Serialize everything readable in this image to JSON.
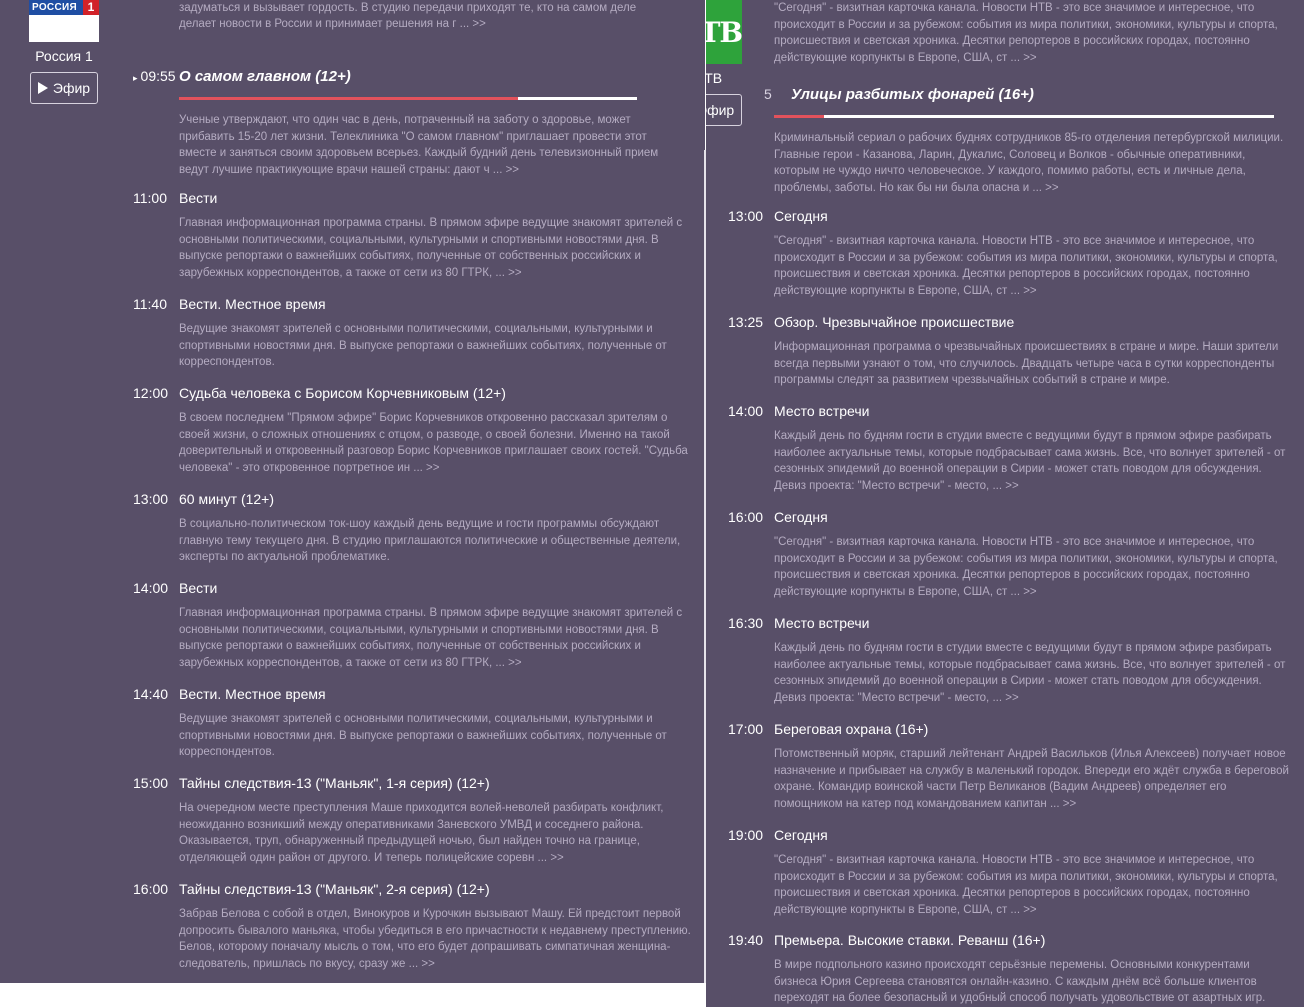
{
  "left": {
    "logo_text": "РОССИЯ",
    "logo_number": "1",
    "channel_name": "Россия 1",
    "live_label": "Эфир",
    "top_fragment": "о том, что интересует каждого жителя большой страны, о том, что тревожит, заставляет задуматься и вызывает гордость. В студию передачи приходят те, кто на самом деле делает новости в России и принимает решения на г ... >>",
    "current": {
      "time": "09:55",
      "title": "О самом главном (12+)",
      "progress": 0.74,
      "desc": "Ученые утверждают, что один час в день, потраченный на заботу о здоровье, может прибавить 15-20 лет жизни. Телеклиника \"О самом главном\" приглашает провести этот вместе и заняться своим здоровьем всерьез. Каждый будний день телевизионный прием ведут лучшие практикующие врачи нашей страны: дают ч ... >>"
    },
    "programs": [
      {
        "time": "11:00",
        "title": "Вести",
        "desc": "Главная информационная программа страны. В прямом эфире ведущие знакомят зрителей с основными политическими, социальными, культурными и спортивными новостями дня. В выпуске репортажи о важнейших событиях, полученные от собственных российских и зарубежных корреспондентов, а также от сети из 80 ГТРК, ... >>"
      },
      {
        "time": "11:40",
        "title": "Вести. Местное время",
        "desc": "Ведущие знакомят зрителей с основными политическими, социальными, культурными и спортивными новостями дня. В выпуске репортажи о важнейших событиях, полученные от корреспондентов."
      },
      {
        "time": "12:00",
        "title": "Судьба человека с Борисом Корчевниковым (12+)",
        "desc": "В своем последнем \"Прямом эфире\" Борис Корчевников откровенно рассказал зрителям о своей жизни, о сложных отношениях с отцом, о разводе, о своей болезни. Именно на такой доверительный и откровенный разговор Борис Корчевников приглашает своих гостей. \"Судьба человека\" - это откровенное портретное ин ... >>"
      },
      {
        "time": "13:00",
        "title": "60 минут (12+)",
        "desc": "В социально-политическом ток-шоу каждый день ведущие и гости программы обсуждают главную тему текущего дня. В студию приглашаются политические и общественные деятели, эксперты по актуальной проблематике."
      },
      {
        "time": "14:00",
        "title": "Вести",
        "desc": "Главная информационная программа страны. В прямом эфире ведущие знакомят зрителей с основными политическими, социальными, культурными и спортивными новостями дня. В выпуске репортажи о важнейших событиях, полученные от собственных российских и зарубежных корреспондентов, а также от сети из 80 ГТРК, ... >>"
      },
      {
        "time": "14:40",
        "title": "Вести. Местное время",
        "desc": "Ведущие знакомят зрителей с основными политическими, социальными, культурными и спортивными новостями дня. В выпуске репортажи о важнейших событиях, полученные от корреспондентов."
      },
      {
        "time": "15:00",
        "title": "Тайны следствия-13 (\"Маньяк\", 1-я серия) (12+)",
        "desc": "На очередном месте преступления Маше приходится волей-неволей разбирать конфликт, неожиданно возникший между оперативниками Заневского УМВД и соседнего района. Оказывается, труп, обнаруженный предыдущей ночью, был найден точно на границе, отделяющей один район от другого. И теперь полицейские соревн ... >>"
      },
      {
        "time": "16:00",
        "title": "Тайны следствия-13 (\"Маньяк\", 2-я серия) (12+)",
        "desc": "Забрав Белова с собой в отдел, Винокуров и Курочкин вызывают Машу. Ей предстоит первой допросить бывалого маньяка, чтобы убедиться в его причастности к недавнему преступлению. Белов, которому поначалу мысль о том, что его будет допрашивать симпатичная женщина-следователь, пришлась по вкусу, сразу же ... >>"
      }
    ]
  },
  "right": {
    "logo_text": "НТВ",
    "channel_name": "НТВ",
    "live_label": "Эфир",
    "top_fragment": "\"Сегодня\" - визитная карточка канала. Новости НТВ - это все значимое и интересное, что происходит в России и за рубежом: события из мира политики, экономики, культуры и спорта, происшествия и светская хроника. Десятки репортеров в российских городах, постоянно действующие корпункты в Европе, США, ст ... >>",
    "current": {
      "time_fragment": "5",
      "title": "Улицы разбитых фонарей (16+)",
      "progress": 0.1,
      "desc": "Криминальный сериал о рабочих буднях сотрудников 85-го отделения петербургской милиции. Главные герои - Казанова, Ларин, Дукалис, Соловец и Волков - обычные оперативники, которым не чуждо ничто человеческое. У каждого, помимо работы, есть и личные дела, проблемы, заботы. Но как бы ни была опасна и ... >>"
    },
    "programs": [
      {
        "time": "13:00",
        "title": "Сегодня",
        "desc": "\"Сегодня\" - визитная карточка канала. Новости НТВ - это все значимое и интересное, что происходит в России и за рубежом: события из мира политики, экономики, культуры и спорта, происшествия и светская хроника. Десятки репортеров в российских городах, постоянно действующие корпункты в Европе, США, ст ... >>"
      },
      {
        "time": "13:25",
        "title": "Обзор. Чрезвычайное происшествие",
        "desc": "Информационная программа о чрезвычайных происшествиях в стране и мире. Наши зрители всегда первыми узнают о том, что случилось. Двадцать четыре часа в сутки корреспонденты программы следят за развитием чрезвычайных событий в стране и мире."
      },
      {
        "time": "14:00",
        "title": "Место встречи",
        "desc": "Каждый день по будням гости в студии вместе с ведущими будут в прямом эфире разбирать наиболее актуальные темы, которые подбрасывает сама жизнь. Все, что волнует зрителей - от сезонных эпидемий до военной операции в Сирии - может стать поводом для обсуждения. Девиз проекта: \"Место встречи\" - место, ... >>"
      },
      {
        "time": "16:00",
        "title": "Сегодня",
        "desc": "\"Сегодня\" - визитная карточка канала. Новости НТВ - это все значимое и интересное, что происходит в России и за рубежом: события из мира политики, экономики, культуры и спорта, происшествия и светская хроника. Десятки репортеров в российских городах, постоянно действующие корпункты в Европе, США, ст ... >>"
      },
      {
        "time": "16:30",
        "title": "Место встречи",
        "desc": "Каждый день по будням гости в студии вместе с ведущими будут в прямом эфире разбирать наиболее актуальные темы, которые подбрасывает сама жизнь. Все, что волнует зрителей - от сезонных эпидемий до военной операции в Сирии - может стать поводом для обсуждения. Девиз проекта: \"Место встречи\" - место, ... >>"
      },
      {
        "time": "17:00",
        "title": "Береговая охрана (16+)",
        "desc": "Потомственный моряк, старший лейтенант Андрей Васильков (Илья Алексеев) получает новое назначение и прибывает на службу в маленький городок. Впереди его ждёт служба в береговой охране. Командир воинской части Петр Великанов (Вадим Андреев) определяет его помощником на катер под командованием капитан ... >>"
      },
      {
        "time": "19:00",
        "title": "Сегодня",
        "desc": "\"Сегодня\" - визитная карточка канала. Новости НТВ - это все значимое и интересное, что происходит в России и за рубежом: события из мира политики, экономики, культуры и спорта, происшествия и светская хроника. Десятки репортеров в российских городах, постоянно действующие корпункты в Европе, США, ст ... >>"
      },
      {
        "time": "19:40",
        "title": "Премьера. Высокие ставки. Реванш (16+)",
        "desc": "В мире подпольного казино происходят серьёзные перемены. Основными конкурентами бизнеса Юрия Сергеева становятся онлайн-казино. С каждым днём всё больше клиентов переходят на более безопасный и удобный способ получать удовольствие от азартных игр."
      }
    ]
  },
  "colors": {
    "panel_bg": "#584f68",
    "desc_text": "#b5acc2",
    "progress_fill": "#e2525c",
    "progress_track": "#ffffff"
  }
}
